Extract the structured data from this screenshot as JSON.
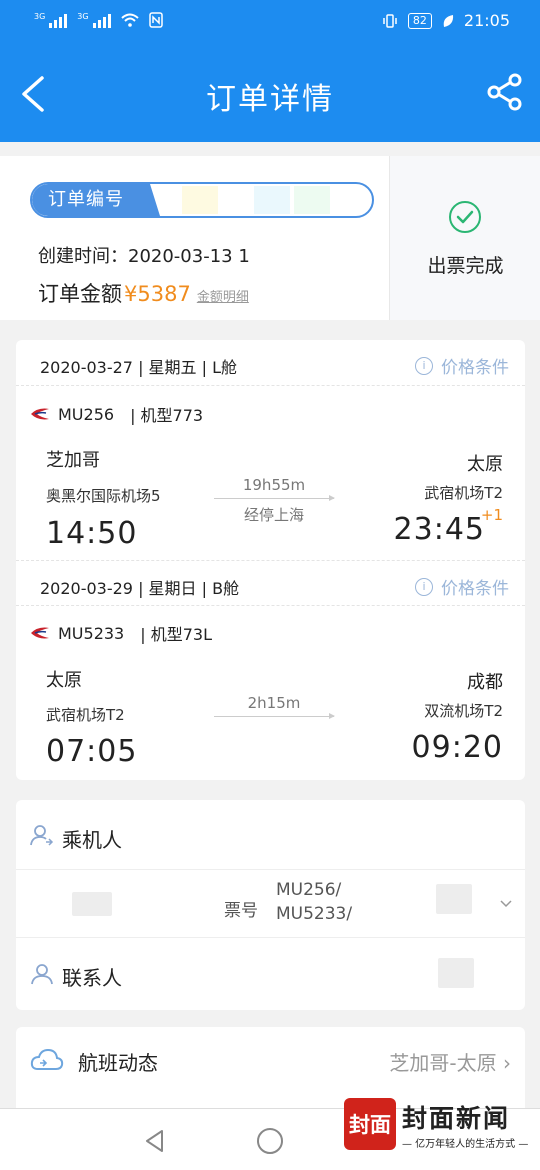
{
  "status_bar": {
    "signal1": "3G",
    "signal2": "3G",
    "battery": "82",
    "time": "21:05"
  },
  "header": {
    "title": "订单详情"
  },
  "order": {
    "number_label": "订单编号",
    "created_label": "创建时间：2020-03-13 1",
    "amount_label": "订单金额",
    "amount_value": "¥5387",
    "amount_detail": "金额明细",
    "status": "出票完成"
  },
  "segments": [
    {
      "date_line": "2020-03-27 | 星期五 | L舱",
      "condition": "价格条件",
      "flight": "MU256",
      "aircraft": "| 机型773",
      "dep_city": "芝加哥",
      "dep_airport": "奥黑尔国际机场5",
      "dep_time": "14:50",
      "duration": "19h55m",
      "stop": "经停上海",
      "arr_city": "太原",
      "arr_airport": "武宿机场T2",
      "arr_time": "23:45",
      "day_offset": "+1"
    },
    {
      "date_line": "2020-03-29 | 星期日 | B舱",
      "condition": "价格条件",
      "flight": "MU5233",
      "aircraft": "| 机型73L",
      "dep_city": "太原",
      "dep_airport": "武宿机场T2",
      "dep_time": "07:05",
      "duration": "2h15m",
      "arr_city": "成都",
      "arr_airport": "双流机场T2",
      "arr_time": "09:20"
    }
  ],
  "passenger": {
    "title": "乘机人",
    "ticket_label": "票号",
    "ticket_line1": "MU256/",
    "ticket_line2": "MU5233/",
    "contact_title": "联系人"
  },
  "dynamics": {
    "label": "航班动态",
    "route": "芝加哥-太原 ›"
  },
  "watermark": {
    "logo": "封面",
    "title": "封面新闻",
    "subtitle": "— 亿万年轻人的生活方式 —"
  },
  "colors": {
    "primary": "#1d8cf0",
    "accent": "#f08c1e",
    "success": "#2bb673"
  }
}
